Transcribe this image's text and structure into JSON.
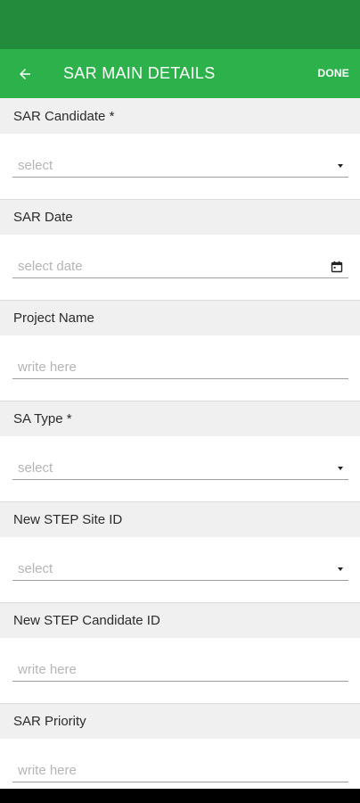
{
  "colors": {
    "status_bar": "#228b3c",
    "app_bar": "#2db24b",
    "section_bg": "#f0f0f0"
  },
  "app_bar": {
    "back_icon": "arrow-left-icon",
    "title": "SAR MAIN DETAILS",
    "done_label": "DONE"
  },
  "sections": [
    {
      "label": "SAR Candidate *",
      "type": "dropdown",
      "placeholder": "select"
    },
    {
      "label": "SAR Date",
      "type": "date",
      "placeholder": "select date"
    },
    {
      "label": "Project Name",
      "type": "text",
      "placeholder": "write here"
    },
    {
      "label": "SA Type *",
      "type": "dropdown",
      "placeholder": "select"
    },
    {
      "label": "New STEP Site ID",
      "type": "dropdown",
      "placeholder": "select"
    },
    {
      "label": "New STEP Candidate ID",
      "type": "text",
      "placeholder": "write here"
    },
    {
      "label": "SAR Priority",
      "type": "text",
      "placeholder": "write here"
    }
  ]
}
